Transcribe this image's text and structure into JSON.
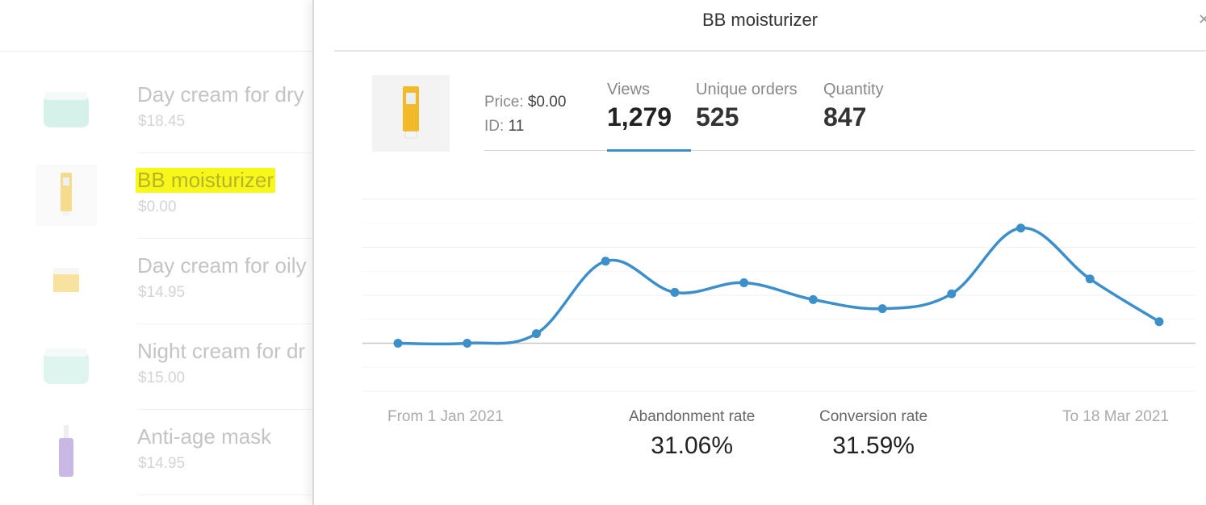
{
  "background_list": {
    "items": [
      {
        "name": "Day cream for dry",
        "price": "$18.45",
        "thumb": "jar-icon",
        "thumb_color": "#cfeee6",
        "highlighted": false
      },
      {
        "name": "BB moisturizer",
        "price": "$0.00",
        "thumb": "tube-icon",
        "thumb_color": "#f4dc8c",
        "highlighted": true
      },
      {
        "name": "Day cream for oily",
        "price": "$14.95",
        "thumb": "jar-icon",
        "thumb_color": "#f8e2a0",
        "highlighted": false
      },
      {
        "name": "Night cream for dr",
        "price": "$15.00",
        "thumb": "jar-icon",
        "thumb_color": "#d8f3ec",
        "highlighted": false
      },
      {
        "name": "Anti-age mask",
        "price": "$14.95",
        "thumb": "bottle-icon",
        "thumb_color": "#c9b8e6",
        "highlighted": false
      }
    ]
  },
  "panel": {
    "title": "BB moisturizer",
    "close_icon": "close-icon",
    "product": {
      "price_label": "Price:",
      "price_value": "$0.00",
      "id_label": "ID:",
      "id_value": "11",
      "thumb_color": "#f2b928"
    },
    "stats": [
      {
        "label": "Views",
        "value": "1,279",
        "active": true
      },
      {
        "label": "Unique orders",
        "value": "525",
        "active": false
      },
      {
        "label": "Quantity",
        "value": "847",
        "active": false
      }
    ],
    "footer": {
      "from": "From 1 Jan 2021",
      "to": "To 18 Mar 2021",
      "abandonment_label": "Abandonment rate",
      "abandonment_value": "31.06%",
      "conversion_label": "Conversion rate",
      "conversion_value": "31.59%"
    },
    "accent_color": "#3d8fca"
  },
  "chart_data": {
    "type": "line",
    "title": "",
    "xlabel": "",
    "ylabel": "",
    "x_start": "1 Jan 2021",
    "x_end": "18 Mar 2021",
    "series": [
      {
        "name": "Views",
        "values": [
          0,
          0,
          0.2,
          1.71,
          1.06,
          1.26,
          0.91,
          0.72,
          1.03,
          2.4,
          1.34,
          0.45
        ]
      }
    ],
    "ylim": [
      -1,
      3
    ],
    "grid": true,
    "smooth": true,
    "line_color": "#3d8fca"
  }
}
